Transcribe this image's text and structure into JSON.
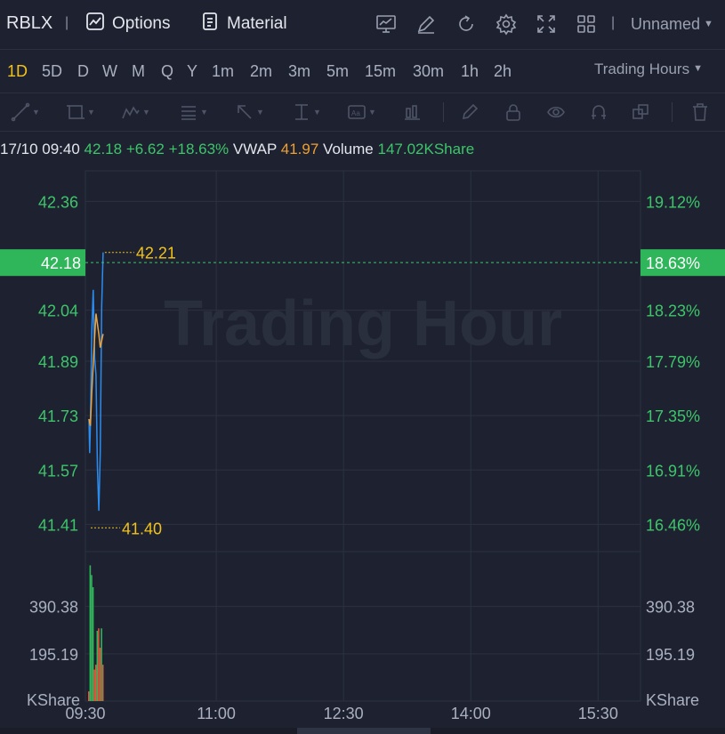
{
  "header": {
    "ticker": "RBLX",
    "separator": "|",
    "options_label": "Options",
    "material_label": "Material",
    "icons": [
      "indicator-icon",
      "draw-pen-icon",
      "refresh-icon",
      "settings-gear-icon",
      "fullscreen-icon",
      "layout-grid-icon"
    ],
    "layout_name": "Unnamed"
  },
  "periods": {
    "items": [
      "1D",
      "5D",
      "D",
      "W",
      "M",
      "Q",
      "Y",
      "1m",
      "2m",
      "3m",
      "5m",
      "15m",
      "30m",
      "1h",
      "2h"
    ],
    "active": "1D",
    "session_select": "Trading Hours"
  },
  "tools": [
    "line-tool-icon",
    "rectangle-tool-icon",
    "pattern-tool-icon",
    "fib-tool-icon",
    "arrow-tool-icon",
    "measure-tool-icon",
    "text-tool-icon",
    "position-tool-icon",
    "edit-pen-icon",
    "lock-icon",
    "visibility-eye-icon",
    "magnet-icon",
    "clone-icon",
    "trash-icon"
  ],
  "info": {
    "time": "17/10 09:40",
    "price": "42.18",
    "change": "+6.62",
    "change_pct": "+18.63%",
    "vwap_label": "VWAP",
    "vwap_value": "41.97",
    "volume_label": "Volume",
    "volume_value": "147.02KShare"
  },
  "chart_data": {
    "type": "line",
    "watermark": "Trading Hour",
    "price_axis": {
      "left_ticks": [
        "42.36",
        "42.04",
        "41.89",
        "41.73",
        "41.57",
        "41.41"
      ],
      "right_ticks": [
        "19.12%",
        "18.23%",
        "17.79%",
        "17.35%",
        "16.91%",
        "16.46%"
      ],
      "ylim": [
        41.33,
        42.45
      ],
      "current_price_label": "42.18",
      "current_pct_label": "18.63%",
      "current_price": 42.18
    },
    "high_marker": {
      "value": 42.21,
      "label": "42.21"
    },
    "low_marker": {
      "value": 41.4,
      "label": "41.40"
    },
    "x_axis": {
      "ticks": [
        "09:30",
        "11:00",
        "12:30",
        "14:00",
        "15:30"
      ],
      "range_minutes": [
        0,
        390
      ]
    },
    "series": [
      {
        "name": "Price",
        "color": "#2b8cf0",
        "x": [
          0,
          0.5,
          1,
          2,
          3,
          4,
          5,
          6,
          7,
          8,
          9,
          10
        ],
        "y": [
          41.72,
          41.62,
          41.7,
          41.98,
          42.1,
          41.9,
          41.85,
          41.58,
          41.45,
          41.62,
          42.05,
          42.21
        ]
      },
      {
        "name": "VWAP",
        "color": "#e8a544",
        "x": [
          0,
          1,
          2,
          3,
          4,
          5,
          6,
          7,
          8,
          9,
          10
        ],
        "y": [
          41.72,
          41.7,
          41.8,
          41.88,
          41.96,
          42.03,
          42.0,
          41.97,
          41.93,
          41.95,
          41.97
        ]
      }
    ],
    "volume": {
      "axis_ticks": [
        "390.38",
        "195.19"
      ],
      "unit_label": "KShare",
      "ylim": [
        0,
        580
      ],
      "x": [
        0,
        1,
        2,
        3,
        4,
        5,
        6,
        7,
        8,
        9,
        10
      ],
      "values": [
        40,
        560,
        520,
        470,
        130,
        150,
        290,
        300,
        220,
        300,
        150
      ],
      "up": [
        false,
        true,
        true,
        true,
        false,
        false,
        true,
        false,
        false,
        true,
        false
      ],
      "up_color": "#2fb55a",
      "down_color": "#e2553c"
    }
  }
}
